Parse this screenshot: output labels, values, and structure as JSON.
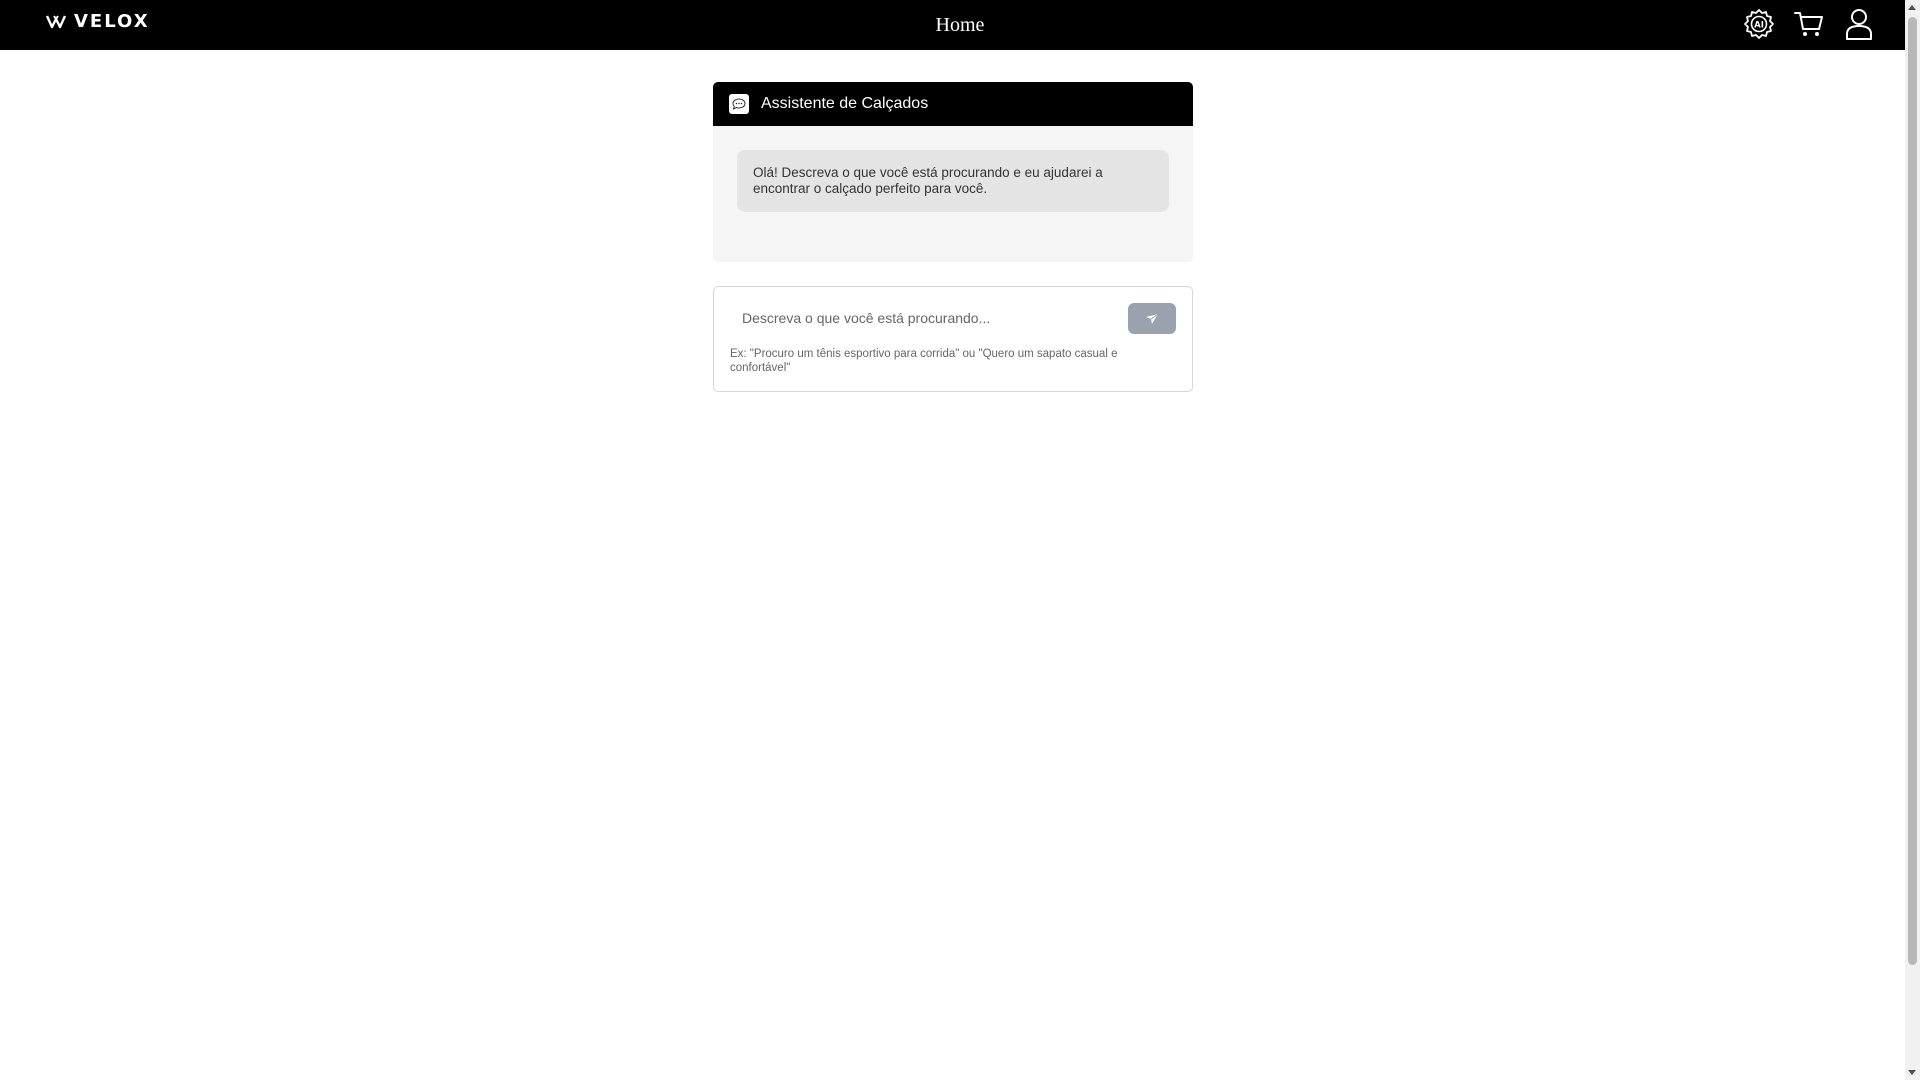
{
  "header": {
    "logo_text": "VELOX",
    "title": "Home",
    "icons": [
      "ai-settings-icon",
      "cart-icon",
      "user-icon"
    ]
  },
  "chat": {
    "title": "Assistente de Calçados",
    "icon": "chat-icon",
    "messages": [
      "Olá! Descreva o que você está procurando e eu ajudarei a encontrar o calçado perfeito para você."
    ]
  },
  "search": {
    "placeholder": "Descreva o que você está procurando...",
    "value": "",
    "send_icon": "send-icon",
    "hint": "Ex: \"Procuro um tênis esportivo para corrida\" ou \"Quero um sapato casual e confortável\""
  },
  "colors": {
    "header_bg": "#000000",
    "chat_bg": "#f5f5f5",
    "bubble_bg": "#e4e4e4",
    "send_button_bg": "#9aa3ad"
  }
}
